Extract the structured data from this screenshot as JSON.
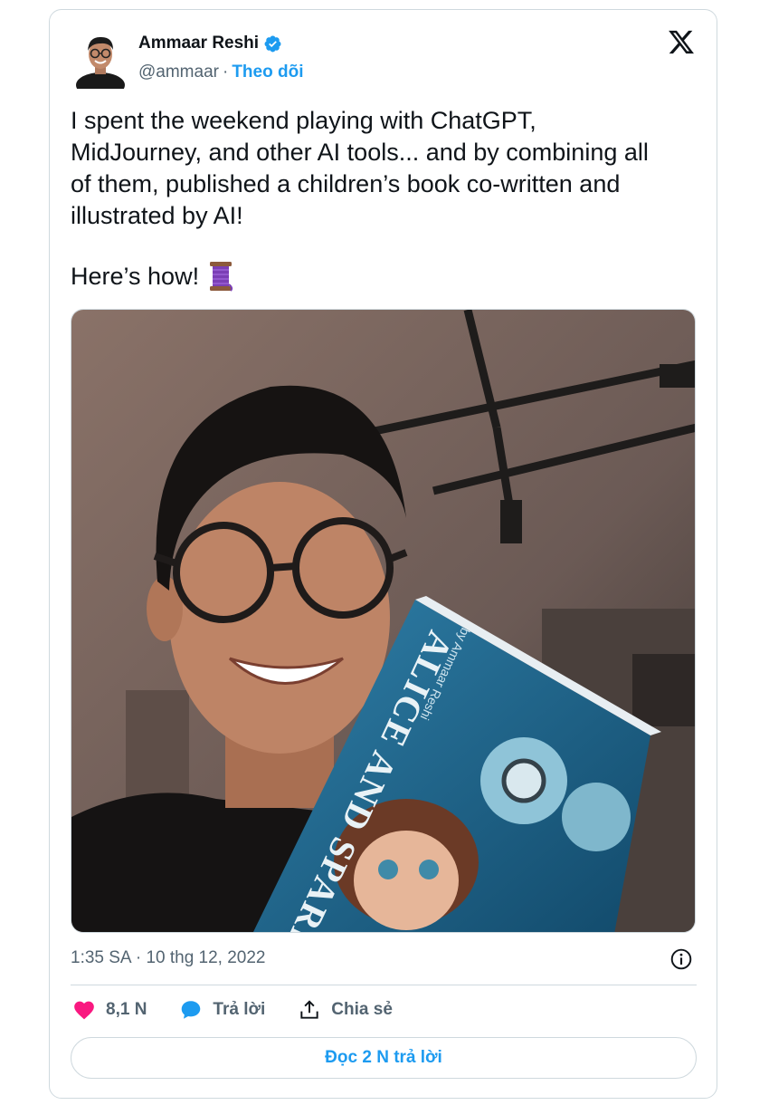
{
  "author": {
    "name": "Ammaar Reshi",
    "handle": "@ammaar",
    "separator": "·",
    "follow_label": "Theo dõi"
  },
  "tweet": {
    "text": "I spent the weekend playing with ChatGPT,\nMidJourney, and other AI tools... and by combining all\nof them, published a children’s book co-written and\nillustrated by AI!",
    "thread_line": "Here’s how!",
    "thread_emoji": "spool-of-thread-emoji"
  },
  "media": {
    "book_title_line1": "ALICE AND SPARK",
    "book_author_line": "by Ammaar Reshi"
  },
  "meta": {
    "timestamp": "1:35 SA · 10 thg 12, 2022"
  },
  "actions": {
    "likes": "8,1 N",
    "reply_label": "Trả lời",
    "share_label": "Chia sẻ"
  },
  "footer": {
    "read_replies_label": "Đọc 2 N trả lời"
  },
  "colors": {
    "accent": "#1d9bf0",
    "like": "#f91880",
    "text": "#0f1419",
    "muted": "#536471",
    "border": "#cfd9de"
  },
  "icons": [
    "verified-badge-icon",
    "x-logo-icon",
    "info-icon",
    "heart-icon",
    "reply-bubble-icon",
    "share-icon"
  ]
}
